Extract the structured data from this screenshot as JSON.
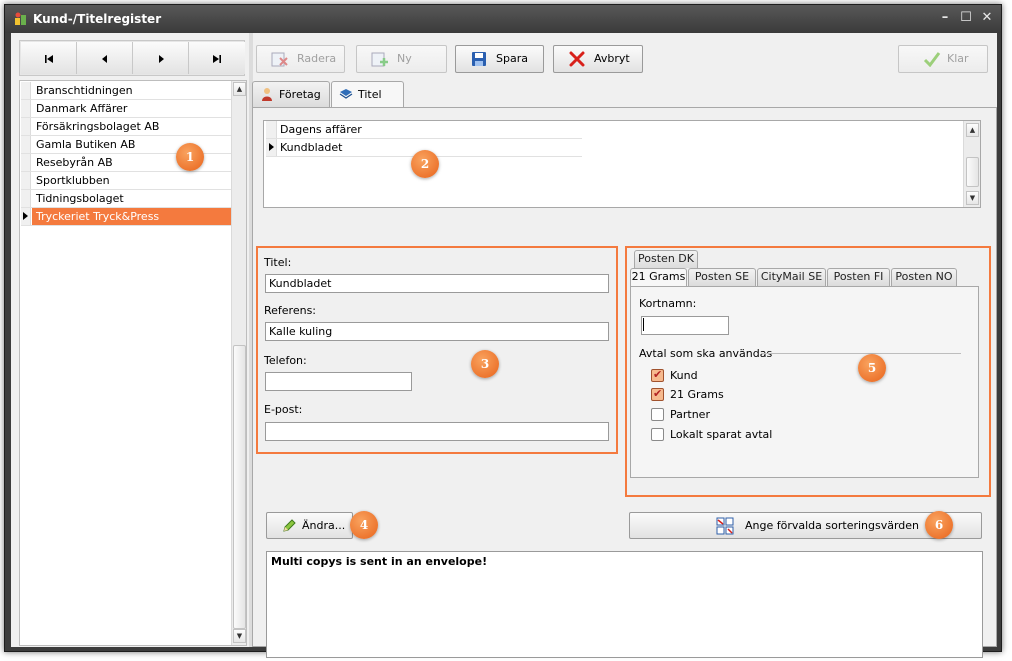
{
  "window": {
    "title": "Kund-/Titelregister"
  },
  "nav": {
    "first": "⏮",
    "prev": "◀",
    "next": "▶",
    "last": "⏭"
  },
  "customers": [
    {
      "name": "Branschtidningen"
    },
    {
      "name": "Danmark Affärer"
    },
    {
      "name": "Försäkringsbolaget AB"
    },
    {
      "name": "Gamla Butiken AB"
    },
    {
      "name": "Resebyrån AB"
    },
    {
      "name": "Sportklubben"
    },
    {
      "name": "Tidningsbolaget"
    },
    {
      "name": "Tryckeriet Tryck&Press",
      "selected": true
    }
  ],
  "toolbar": {
    "radera": "Radera",
    "ny": "Ny",
    "spara": "Spara",
    "avbryt": "Avbryt",
    "klar": "Klar"
  },
  "tabs": {
    "foretag": "Företag",
    "titel": "Titel"
  },
  "titles": [
    {
      "name": "Dagens affärer"
    },
    {
      "name": "Kundbladet",
      "current": true
    }
  ],
  "form": {
    "titel_label": "Titel:",
    "titel_value": "Kundbladet",
    "referens_label": "Referens:",
    "referens_value": "Kalle kuling",
    "telefon_label": "Telefon:",
    "telefon_value": "",
    "epost_label": "E-post:",
    "epost_value": ""
  },
  "posten": {
    "tabs_row1": [
      "Posten DK"
    ],
    "tabs_row2": [
      "21 Grams",
      "Posten SE",
      "CityMail SE",
      "Posten FI",
      "Posten NO"
    ],
    "active_tab": "21 Grams",
    "kortnamn_label": "Kortnamn:",
    "kortnamn_value": "",
    "avtal_label": "Avtal som ska användas",
    "agreements": [
      {
        "label": "Kund",
        "checked": true
      },
      {
        "label": "21 Grams",
        "checked": true
      },
      {
        "label": "Partner",
        "checked": false
      },
      {
        "label": "Lokalt sparat avtal",
        "checked": false
      }
    ]
  },
  "buttons": {
    "andra": "Ändra...",
    "sortering": "Ange förvalda sorteringsvärden"
  },
  "memo": {
    "text": "Multi copys is sent in an envelope!"
  },
  "badges": [
    "1",
    "2",
    "3",
    "4",
    "5",
    "6"
  ],
  "colors": {
    "accent": "#f47a3e",
    "badge": "#e8631b",
    "check": "#b22222"
  }
}
